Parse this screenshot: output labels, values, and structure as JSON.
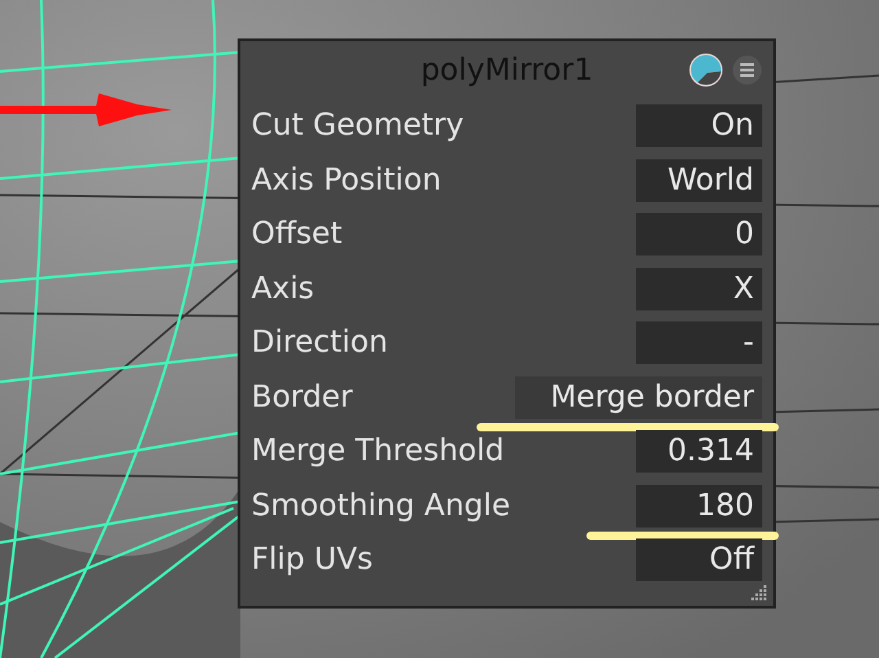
{
  "panel": {
    "title": "polyMirror1",
    "rows": [
      {
        "label": "Cut Geometry",
        "value": "On",
        "wide": false,
        "underlined": false
      },
      {
        "label": "Axis Position",
        "value": "World",
        "wide": false,
        "underlined": false
      },
      {
        "label": "Offset",
        "value": "0",
        "wide": false,
        "underlined": false
      },
      {
        "label": "Axis",
        "value": "X",
        "wide": false,
        "underlined": false
      },
      {
        "label": "Direction",
        "value": "-",
        "wide": false,
        "underlined": false
      },
      {
        "label": "Border",
        "value": "Merge border",
        "wide": true,
        "underlined": true
      },
      {
        "label": "Merge Threshold",
        "value": "0.314",
        "wide": false,
        "underlined": false
      },
      {
        "label": "Smoothing Angle",
        "value": "180",
        "wide": false,
        "underlined": true
      },
      {
        "label": "Flip UVs",
        "value": "Off",
        "wide": false,
        "underlined": false
      }
    ]
  }
}
